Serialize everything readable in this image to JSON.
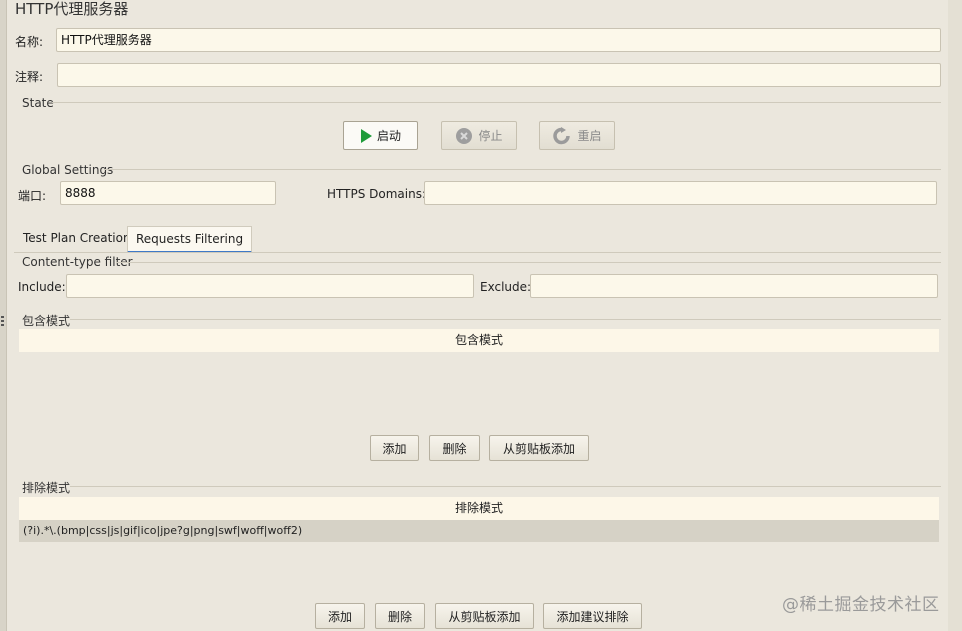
{
  "title": "HTTP代理服务器",
  "name_label": "名称:",
  "name_value": "HTTP代理服务器",
  "comment_label": "注释:",
  "comment_value": "",
  "state": {
    "header": "State",
    "start": "启动",
    "stop": "停止",
    "restart": "重启"
  },
  "global": {
    "header": "Global Settings",
    "port_label": "端口:",
    "port_value": "8888",
    "https_label": "HTTPS Domains:",
    "https_value": ""
  },
  "tabs": [
    "Test Plan Creation",
    "Requests Filtering"
  ],
  "content_type": {
    "header": "Content-type filter",
    "include_label": "Include:",
    "include_value": "",
    "exclude_label": "Exclude:",
    "exclude_value": ""
  },
  "include_patterns": {
    "header": "包含模式",
    "column": "包含模式",
    "rows": [],
    "buttons": [
      "添加",
      "删除",
      "从剪贴板添加"
    ]
  },
  "exclude_patterns": {
    "header": "排除模式",
    "column": "排除模式",
    "rows": [
      "(?i).*\\.(bmp|css|js|gif|ico|jpe?g|png|swf|woff|woff2)"
    ],
    "buttons": [
      "添加",
      "删除",
      "从剪贴板添加",
      "添加建议排除"
    ]
  },
  "watermark": "@稀土掘金技术社区",
  "colors": {
    "start_icon": "#1f9b3a",
    "tab_underline": "#3f79c7",
    "selected_row": "#d6d2c6",
    "field_bg": "#fcf8ea"
  }
}
